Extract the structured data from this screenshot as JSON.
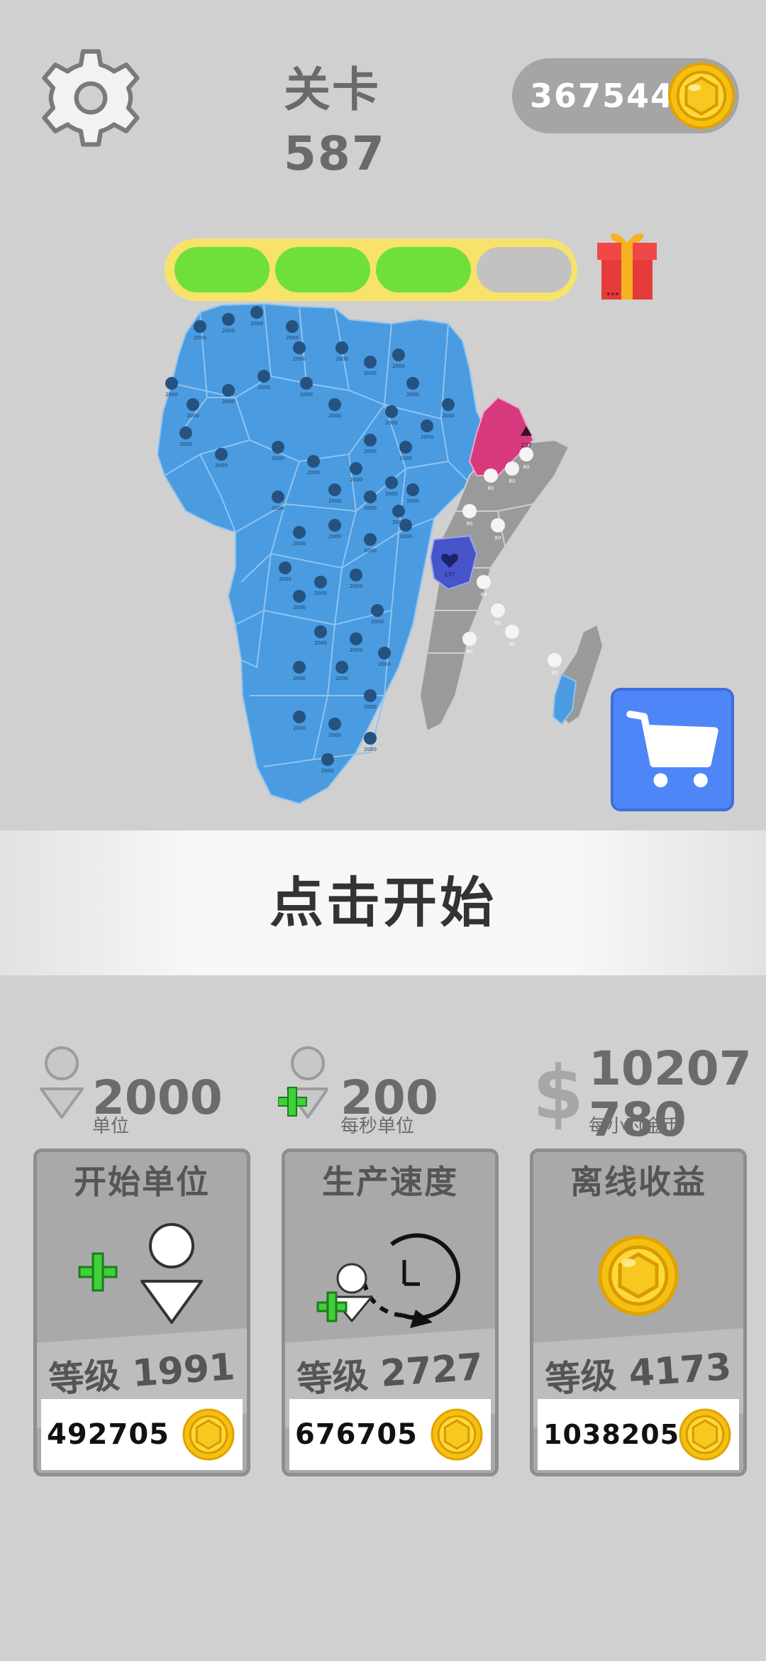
{
  "header": {
    "level_label": "关卡 587",
    "coins": "367544",
    "settings_icon": "gear-icon",
    "coin_icon": "gold-coin-icon"
  },
  "progress": {
    "segments_total": 4,
    "segments_filled": 3,
    "filled_color": "#6fe03a",
    "empty_color": "#c2c2c2",
    "frame_color": "#f7e36a",
    "reward_icon": "gift-box-icon"
  },
  "map": {
    "region": "Africa",
    "player_color": "#4a9be0",
    "neutral_color": "#9a9a9a",
    "enemy_colors": [
      "#d63a7d",
      "#4655c9"
    ],
    "player_unit_label": "2000",
    "neutral_unit_label": "80",
    "enemy_unit_label": "237"
  },
  "shop": {
    "icon": "shopping-cart-icon",
    "color": "#4f86f7"
  },
  "start": {
    "label": "点击开始"
  },
  "stats": [
    {
      "value": "2000",
      "unit": "单位",
      "icon": "unit-person-icon"
    },
    {
      "value": "200",
      "unit": "每秒单位",
      "icon": "unit-plus-icon"
    },
    {
      "value": "10207\n780",
      "unit": "每小时金币",
      "icon": "dollar-icon"
    }
  ],
  "upgrades": [
    {
      "title": "开始单位",
      "level_prefix": "等级",
      "level": "1991",
      "price": "492705",
      "icon": "add-unit-icon"
    },
    {
      "title": "生产速度",
      "level_prefix": "等级",
      "level": "2727",
      "price": "676705",
      "icon": "unit-clock-icon"
    },
    {
      "title": "离线收益",
      "level_prefix": "等级",
      "level": "4173",
      "price": "1038205",
      "icon": "gold-coin-icon"
    }
  ]
}
